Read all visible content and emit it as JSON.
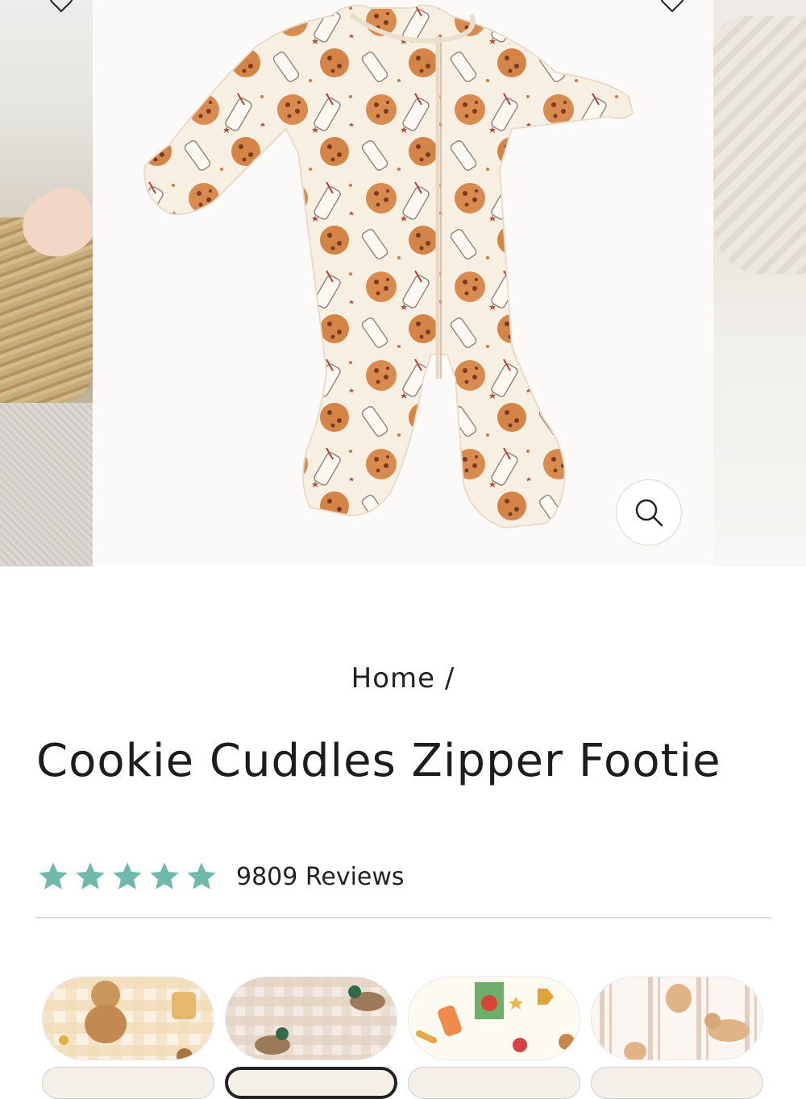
{
  "gallery": {
    "main_image_alt": "Cookie Cuddles Zipper Footie",
    "zoom_icon": "search-icon",
    "favorite_icon": "heart-icon"
  },
  "breadcrumb": {
    "home": "Home /"
  },
  "product": {
    "title": "Cookie Cuddles Zipper Footie",
    "rating": 5,
    "reviews": "9809 Reviews",
    "star_color": "#6fb8ac"
  },
  "swatches": [
    {
      "name": "bear-gingham-swatch"
    },
    {
      "name": "duck-gingham-swatch"
    },
    {
      "name": "snacks-swatch"
    },
    {
      "name": "puppy-stripes-swatch"
    }
  ]
}
